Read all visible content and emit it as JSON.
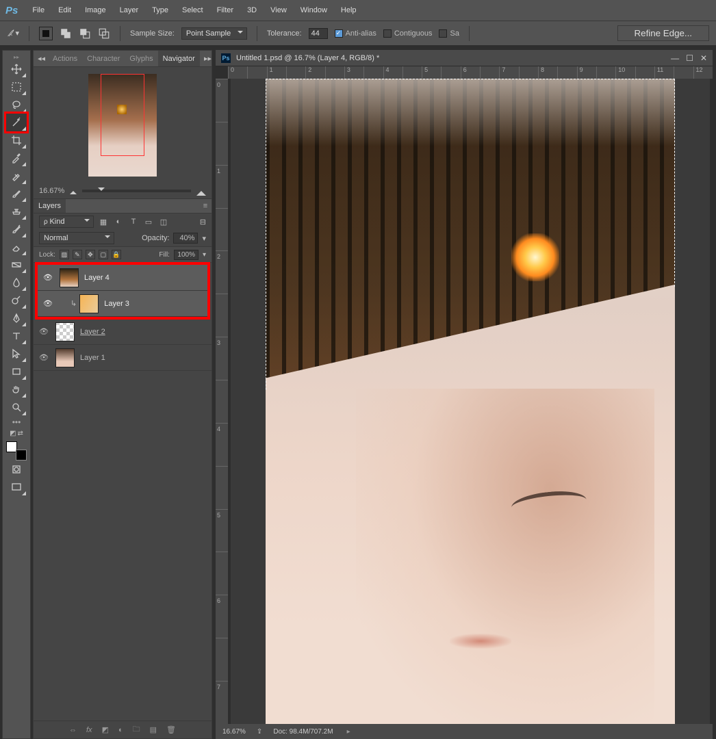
{
  "menu": [
    "File",
    "Edit",
    "Image",
    "Layer",
    "Type",
    "Select",
    "Filter",
    "3D",
    "View",
    "Window",
    "Help"
  ],
  "optbar": {
    "sample_label": "Sample Size:",
    "sample_value": "Point Sample",
    "tolerance_label": "Tolerance:",
    "tolerance_value": "44",
    "antialias": "Anti-alias",
    "contiguous": "Contiguous",
    "sample_all": "Sa",
    "refine": "Refine Edge..."
  },
  "navigator": {
    "tabs": [
      "Actions",
      "Character",
      "Glyphs",
      "Navigator"
    ],
    "zoom": "16.67%"
  },
  "layers": {
    "tab": "Layers",
    "filter_kind": "Kind",
    "blend": "Normal",
    "opacity_label": "Opacity:",
    "opacity": "40%",
    "lock_label": "Lock:",
    "fill_label": "Fill:",
    "fill": "100%",
    "items": [
      {
        "name": "Layer 4",
        "selected": true,
        "clip": false,
        "thumb": "t4"
      },
      {
        "name": "Layer 3",
        "selected": true,
        "clip": true,
        "thumb": "t3"
      },
      {
        "name": "Layer 2",
        "selected": false,
        "clip": false,
        "thumb": "t2",
        "underline": true
      },
      {
        "name": "Layer 1",
        "selected": false,
        "clip": false,
        "thumb": "t1"
      }
    ]
  },
  "doc": {
    "title": "Untitled 1.psd @ 16.7% (Layer 4, RGB/8) *",
    "ruler_h": [
      "0",
      "",
      "1",
      "",
      "2",
      "",
      "3",
      "",
      "4",
      "",
      "5",
      "",
      "6",
      "",
      "7",
      "",
      "8",
      "",
      "9",
      "",
      "10",
      "",
      "11",
      "",
      "12"
    ],
    "ruler_v": [
      "0",
      "",
      "1",
      "",
      "2",
      "",
      "3",
      "",
      "4",
      "",
      "5",
      "",
      "6",
      "",
      "7"
    ],
    "status_zoom": "16.67%",
    "status_doc": "Doc: 98.4M/707.2M"
  },
  "search_placeholder": "ρ Kind"
}
